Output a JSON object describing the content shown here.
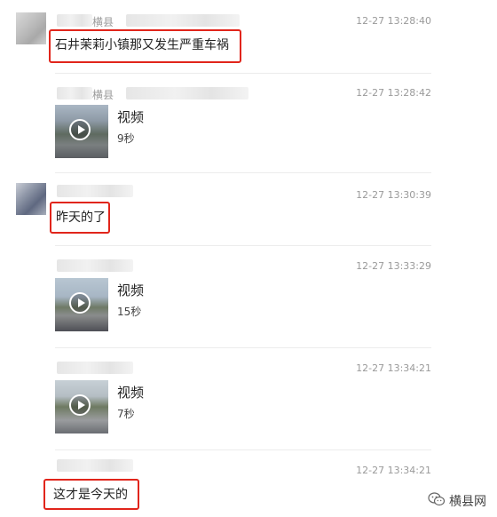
{
  "messages": [
    {
      "name": "横县",
      "timestamp": "12-27 13:28:40",
      "text": "石井茉莉小镇那又发生严重车祸"
    },
    {
      "name": "横县",
      "timestamp": "12-27 13:28:42",
      "video_label": "视频",
      "duration": "9秒"
    },
    {
      "timestamp": "12-27 13:30:39",
      "text": "昨天的了"
    },
    {
      "timestamp": "12-27 13:33:29",
      "video_label": "视频",
      "duration": "15秒"
    },
    {
      "timestamp": "12-27 13:34:21",
      "video_label": "视频",
      "duration": "7秒"
    },
    {
      "timestamp": "12-27 13:34:21",
      "text": "这才是今天的"
    }
  ],
  "watermark": {
    "text": "横县网",
    "icon": "wechat-icon"
  },
  "colors": {
    "highlight": "#e1251b",
    "timestamp": "#9a9a9a"
  }
}
